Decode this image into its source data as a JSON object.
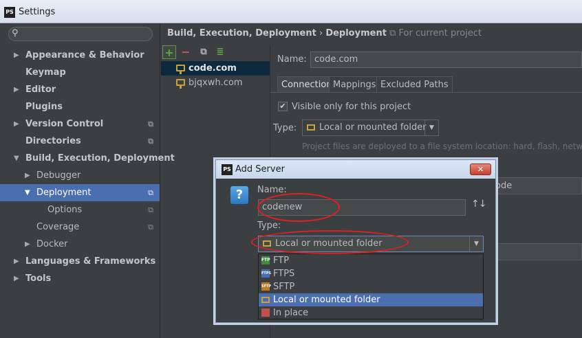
{
  "window": {
    "title": "Settings",
    "logo": "PS"
  },
  "search": {
    "placeholder": "",
    "icon": "search-icon"
  },
  "nav": {
    "items": [
      {
        "label": "Appearance & Behavior",
        "arrow": "▶"
      },
      {
        "label": "Keymap",
        "arrow": ""
      },
      {
        "label": "Editor",
        "arrow": "▶"
      },
      {
        "label": "Plugins",
        "arrow": ""
      },
      {
        "label": "Version Control",
        "arrow": "▶"
      },
      {
        "label": "Directories",
        "arrow": ""
      },
      {
        "label": "Build, Execution, Deployment",
        "arrow": "▼"
      },
      {
        "label": "Debugger",
        "arrow": "▶"
      },
      {
        "label": "Deployment",
        "arrow": "▼"
      },
      {
        "label": "Options",
        "arrow": ""
      },
      {
        "label": "Coverage",
        "arrow": ""
      },
      {
        "label": "Docker",
        "arrow": "▶"
      },
      {
        "label": "Languages & Frameworks",
        "arrow": "▶"
      },
      {
        "label": "Tools",
        "arrow": "▶"
      }
    ]
  },
  "breadcrumb": {
    "part1": "Build, Execution, Deployment",
    "sep": "›",
    "part2": "Deployment",
    "note": "For current project"
  },
  "toolbar": {
    "add": "+",
    "remove": "−"
  },
  "servers": [
    {
      "label": "code.com"
    },
    {
      "label": "bjqxwh.com"
    }
  ],
  "form": {
    "name_label": "Name:",
    "name_value": "code.com",
    "tabs": [
      "Connection",
      "Mappings",
      "Excluded Paths"
    ],
    "visible_only": "Visible only for this project",
    "type_label": "Type:",
    "type_value": "Local or mounted folder",
    "hint": "Project files are deployed to a file system location: hard, flash, networ",
    "partial_value": "ode"
  },
  "dialog": {
    "title": "Add Server",
    "logo": "PS",
    "close": "✕",
    "name_label": "Name:",
    "name_value": "codenew",
    "type_label": "Type:",
    "type_value": "Local or mounted folder",
    "options": [
      {
        "label": "FTP",
        "icon": "ftp-icon",
        "abbr": "FTP",
        "color": "#3c8c3c"
      },
      {
        "label": "FTPS",
        "icon": "ftps-icon",
        "abbr": "FTPS",
        "color": "#4a6fb0"
      },
      {
        "label": "SFTP",
        "icon": "sftp-icon",
        "abbr": "SFTP",
        "color": "#c27a22"
      },
      {
        "label": "Local or mounted folder",
        "icon": "folder-icon",
        "abbr": "",
        "color": "#c8a23a"
      },
      {
        "label": "In place",
        "icon": "in-place-icon",
        "abbr": "",
        "color": "#c0504d"
      }
    ]
  },
  "colors": {
    "selection": "#4b6eaf",
    "annotation": "#e02020"
  }
}
